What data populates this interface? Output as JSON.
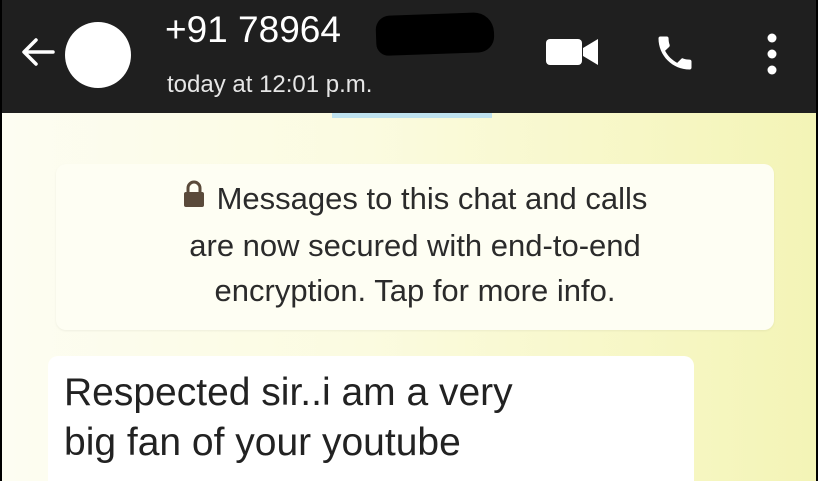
{
  "header": {
    "contact_name": "+91 78964",
    "last_seen": "today at 12:01 p.m.",
    "icons": {
      "back": "back-arrow-icon",
      "video": "video-call-icon",
      "call": "phone-icon",
      "menu": "more-vertical-icon"
    }
  },
  "encryption_notice": {
    "icon": "lock-icon",
    "line1": "Messages to this chat and calls",
    "line2": "are now secured with end-to-end",
    "line3": "encryption. Tap for more info."
  },
  "messages": [
    {
      "line1": "Respected sir..i am a very",
      "line2": "big fan of your youtube"
    }
  ],
  "colors": {
    "header_bg": "#1f1f1f",
    "chat_bg": "#fbfbe0",
    "bubble_bg": "#ffffff"
  }
}
